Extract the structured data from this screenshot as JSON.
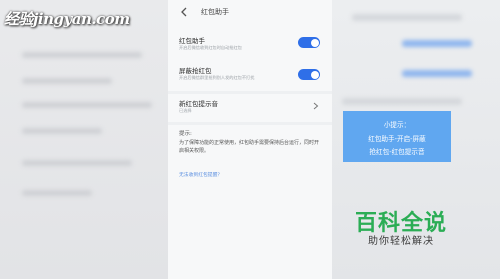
{
  "watermark": {
    "logo_text": "经验jingyan.com"
  },
  "header": {
    "back_icon": "chevron-left-icon",
    "title": "红包助手"
  },
  "settings": [
    {
      "title": "红包助手",
      "subtitle": "开启后微信收到红包时自动抢红包",
      "toggle_on": true
    },
    {
      "title": "屏蔽抢红包",
      "subtitle": "开启后微信群里抢到别人发的红包不打扰",
      "toggle_on": true
    },
    {
      "title": "新红包提示音",
      "subtitle": "已选择",
      "chevron": "chevron-right-icon"
    }
  ],
  "tip": {
    "heading": "提示:",
    "body": "为了保障功能的正常使用，红包助手需要保持后台运行，同时开启相关权限。",
    "link": "无法收到红包提醒？"
  },
  "note": {
    "line1": "小提示：",
    "line2": "红包助手-开启-屏蔽",
    "line3": "抢红包-红包提示音"
  },
  "brand": {
    "title": "百科全说",
    "subtitle": "助你轻松解决"
  },
  "colors": {
    "toggle": "#2f6fe8",
    "note_bg": "#60a7f0",
    "brand_green": "#2bad55"
  }
}
